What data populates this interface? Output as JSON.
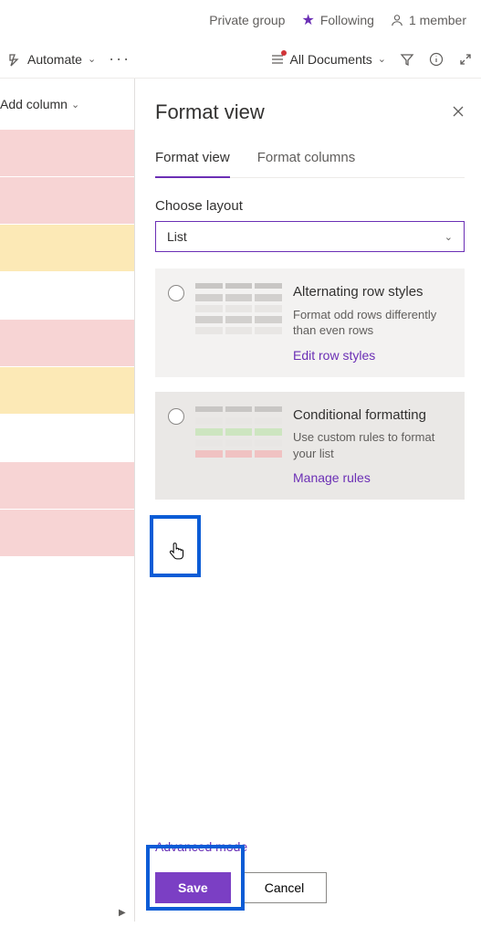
{
  "header": {
    "group_type": "Private group",
    "following_label": "Following",
    "member_count": "1 member"
  },
  "toolbar": {
    "automate_label": "Automate",
    "views_label": "All Documents"
  },
  "left": {
    "add_column_label": "Add column"
  },
  "panel": {
    "title": "Format view",
    "tabs": {
      "format_view": "Format view",
      "format_columns": "Format columns"
    },
    "choose_layout_label": "Choose layout",
    "layout_value": "List",
    "option1": {
      "title": "Alternating row styles",
      "desc": "Format odd rows differently than even rows",
      "link": "Edit row styles"
    },
    "option2": {
      "title": "Conditional formatting",
      "desc": "Use custom rules to format your list",
      "link": "Manage rules"
    },
    "advanced_label": "Advanced mode",
    "save_label": "Save",
    "cancel_label": "Cancel"
  }
}
